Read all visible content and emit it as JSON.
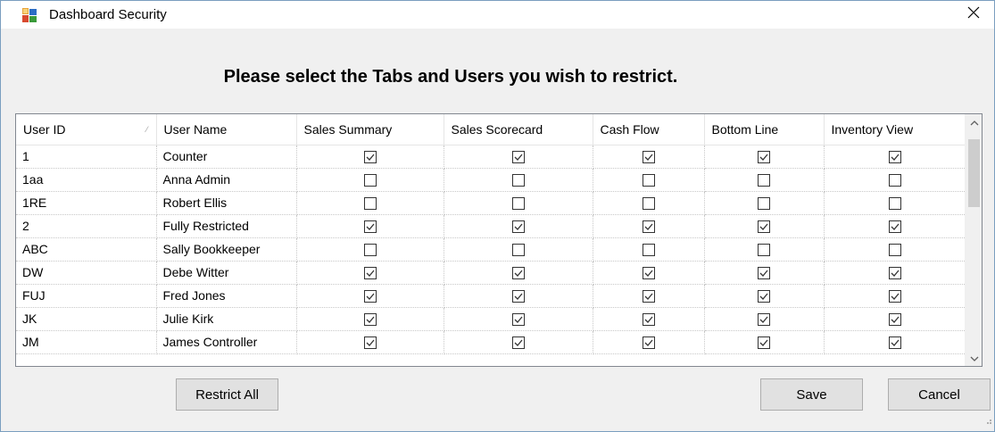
{
  "window": {
    "title": "Dashboard Security"
  },
  "icons": {
    "app": "app-window-icon",
    "close": "close-icon",
    "sort": "sort-indicator-icon",
    "scroll_up": "chevron-up-icon",
    "scroll_down": "chevron-down-icon",
    "check": "check-icon"
  },
  "heading": "Please select the Tabs and Users you wish to restrict.",
  "grid": {
    "columns": [
      "User ID",
      "User Name",
      "Sales Summary",
      "Sales Scorecard",
      "Cash Flow",
      "Bottom Line",
      "Inventory View"
    ],
    "sort_indicator": "⁄",
    "rows": [
      {
        "id": "1",
        "name": "Counter",
        "checks": [
          true,
          true,
          true,
          true,
          true
        ]
      },
      {
        "id": "1aa",
        "name": "Anna Admin",
        "checks": [
          false,
          false,
          false,
          false,
          false
        ]
      },
      {
        "id": "1RE",
        "name": "Robert Ellis",
        "checks": [
          false,
          false,
          false,
          false,
          false
        ]
      },
      {
        "id": "2",
        "name": "Fully Restricted",
        "checks": [
          true,
          true,
          true,
          true,
          true
        ]
      },
      {
        "id": "ABC",
        "name": "Sally Bookkeeper",
        "checks": [
          false,
          false,
          false,
          false,
          false
        ]
      },
      {
        "id": "DW",
        "name": "Debe Witter",
        "checks": [
          true,
          true,
          true,
          true,
          true
        ]
      },
      {
        "id": "FUJ",
        "name": "Fred Jones",
        "checks": [
          true,
          true,
          true,
          true,
          true
        ]
      },
      {
        "id": "JK",
        "name": "Julie Kirk",
        "checks": [
          true,
          true,
          true,
          true,
          true
        ]
      },
      {
        "id": "JM",
        "name": "James Controller",
        "checks": [
          true,
          true,
          true,
          true,
          true
        ]
      }
    ]
  },
  "buttons": {
    "restrict_all": "Restrict All",
    "save": "Save",
    "cancel": "Cancel"
  },
  "colors": {
    "window_bg": "#f0f0f0",
    "grid_bg": "#ffffff",
    "button_bg": "#e1e1e1",
    "border": "#828790"
  }
}
